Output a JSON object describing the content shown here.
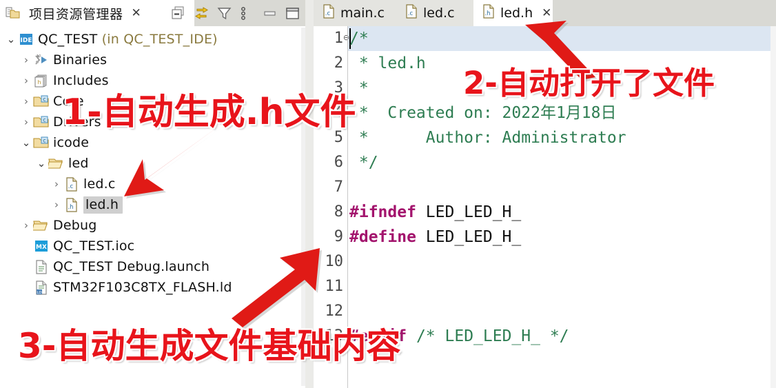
{
  "left_panel": {
    "title": "项目资源管理器",
    "close_label": "✕",
    "toolbar": [
      {
        "name": "collapse-all-icon",
        "label": "collapse-all"
      },
      {
        "name": "link-with-editor-icon",
        "label": "link-with-editor"
      },
      {
        "name": "filter-icon",
        "label": "filter"
      },
      {
        "name": "view-menu-icon",
        "label": "view-menu"
      },
      {
        "name": "minimize-icon",
        "label": "minimize"
      },
      {
        "name": "maximize-icon",
        "label": "maximize"
      }
    ],
    "tree": [
      {
        "label": "QC_TEST",
        "suffix": " (in QC_TEST_IDE)",
        "indent": 0,
        "twist": "open",
        "icon": "ide-project-icon",
        "selected": false
      },
      {
        "label": "Binaries",
        "suffix": "",
        "indent": 1,
        "twist": "closed",
        "icon": "binaries-icon",
        "selected": false
      },
      {
        "label": "Includes",
        "suffix": "",
        "indent": 1,
        "twist": "closed",
        "icon": "includes-icon",
        "selected": false
      },
      {
        "label": "Core",
        "suffix": "",
        "indent": 1,
        "twist": "closed",
        "icon": "source-folder-icon",
        "selected": false
      },
      {
        "label": "Drivers",
        "suffix": "",
        "indent": 1,
        "twist": "closed",
        "icon": "source-folder-icon",
        "selected": false
      },
      {
        "label": "icode",
        "suffix": "",
        "indent": 1,
        "twist": "open",
        "icon": "source-folder-icon",
        "selected": false
      },
      {
        "label": "led",
        "suffix": "",
        "indent": 2,
        "twist": "open",
        "icon": "folder-open-icon",
        "selected": false
      },
      {
        "label": "led.c",
        "suffix": "",
        "indent": 3,
        "twist": "closed",
        "icon": "c-file-icon",
        "selected": false
      },
      {
        "label": "led.h",
        "suffix": "",
        "indent": 3,
        "twist": "closed",
        "icon": "h-file-icon",
        "selected": true
      },
      {
        "label": "Debug",
        "suffix": "",
        "indent": 1,
        "twist": "closed",
        "icon": "folder-open-icon",
        "selected": false
      },
      {
        "label": "QC_TEST.ioc",
        "suffix": "",
        "indent": 1,
        "twist": "none",
        "icon": "mx-ioc-icon",
        "selected": false
      },
      {
        "label": "QC_TEST Debug.launch",
        "suffix": "",
        "indent": 1,
        "twist": "none",
        "icon": "launch-file-icon",
        "selected": false
      },
      {
        "label": "STM32F103C8TX_FLASH.ld",
        "suffix": "",
        "indent": 1,
        "twist": "none",
        "icon": "ld-file-icon",
        "selected": false
      }
    ]
  },
  "editor": {
    "tabs": [
      {
        "label": "main.c",
        "icon": "c-file-icon",
        "active": false,
        "closable": false
      },
      {
        "label": "led.c",
        "icon": "c-file-icon",
        "active": false,
        "closable": false
      },
      {
        "label": "led.h",
        "icon": "h-file-icon",
        "active": true,
        "closable": true
      }
    ],
    "tab_close_label": "✕",
    "fold_marker": "⊖",
    "line_numbers": [
      "1",
      "2",
      "3",
      "4",
      "5",
      "6",
      "7",
      "8",
      "9",
      "10",
      "11",
      "12",
      "13"
    ],
    "lines": [
      {
        "n": 1,
        "segments": [
          {
            "t": "/*",
            "k": "cmt"
          }
        ]
      },
      {
        "n": 2,
        "segments": [
          {
            "t": " * led.h",
            "k": "cmt"
          }
        ]
      },
      {
        "n": 3,
        "segments": [
          {
            "t": " *",
            "k": "cmt"
          }
        ]
      },
      {
        "n": 4,
        "segments": [
          {
            "t": " *  Created on: 2022年1月18日",
            "k": "cmt"
          }
        ]
      },
      {
        "n": 5,
        "segments": [
          {
            "t": " *      Author: Administrator",
            "k": "cmt"
          }
        ]
      },
      {
        "n": 6,
        "segments": [
          {
            "t": " */",
            "k": "cmt"
          }
        ]
      },
      {
        "n": 7,
        "segments": []
      },
      {
        "n": 8,
        "segments": [
          {
            "t": "#ifndef",
            "k": "pre"
          },
          {
            "t": " LED_LED_H_",
            "k": "ident"
          }
        ]
      },
      {
        "n": 9,
        "segments": [
          {
            "t": "#define",
            "k": "pre"
          },
          {
            "t": " LED_LED_H_",
            "k": "ident"
          }
        ]
      },
      {
        "n": 10,
        "segments": []
      },
      {
        "n": 11,
        "segments": []
      },
      {
        "n": 12,
        "segments": []
      },
      {
        "n": 13,
        "segments": [
          {
            "t": "#endif",
            "k": "pre"
          },
          {
            "t": " ",
            "k": "ident"
          },
          {
            "t": "/* LED_LED_H_ */",
            "k": "cmt"
          }
        ]
      }
    ]
  },
  "annotations": [
    {
      "name": "annotation-1",
      "text": "1-自动生成.h文件"
    },
    {
      "name": "annotation-2",
      "text": "2-自动打开了文件"
    },
    {
      "name": "annotation-3",
      "text": "3-自动生成文件基础内容"
    }
  ],
  "colors": {
    "annotation_red": "#e8141b",
    "comment_green": "#2e7d52",
    "preprocessor_purple": "#a3146d",
    "selection_gray": "#cfcfcf",
    "current_line_blue": "#dce6f2",
    "chrome_gray": "#d9d9d4"
  }
}
